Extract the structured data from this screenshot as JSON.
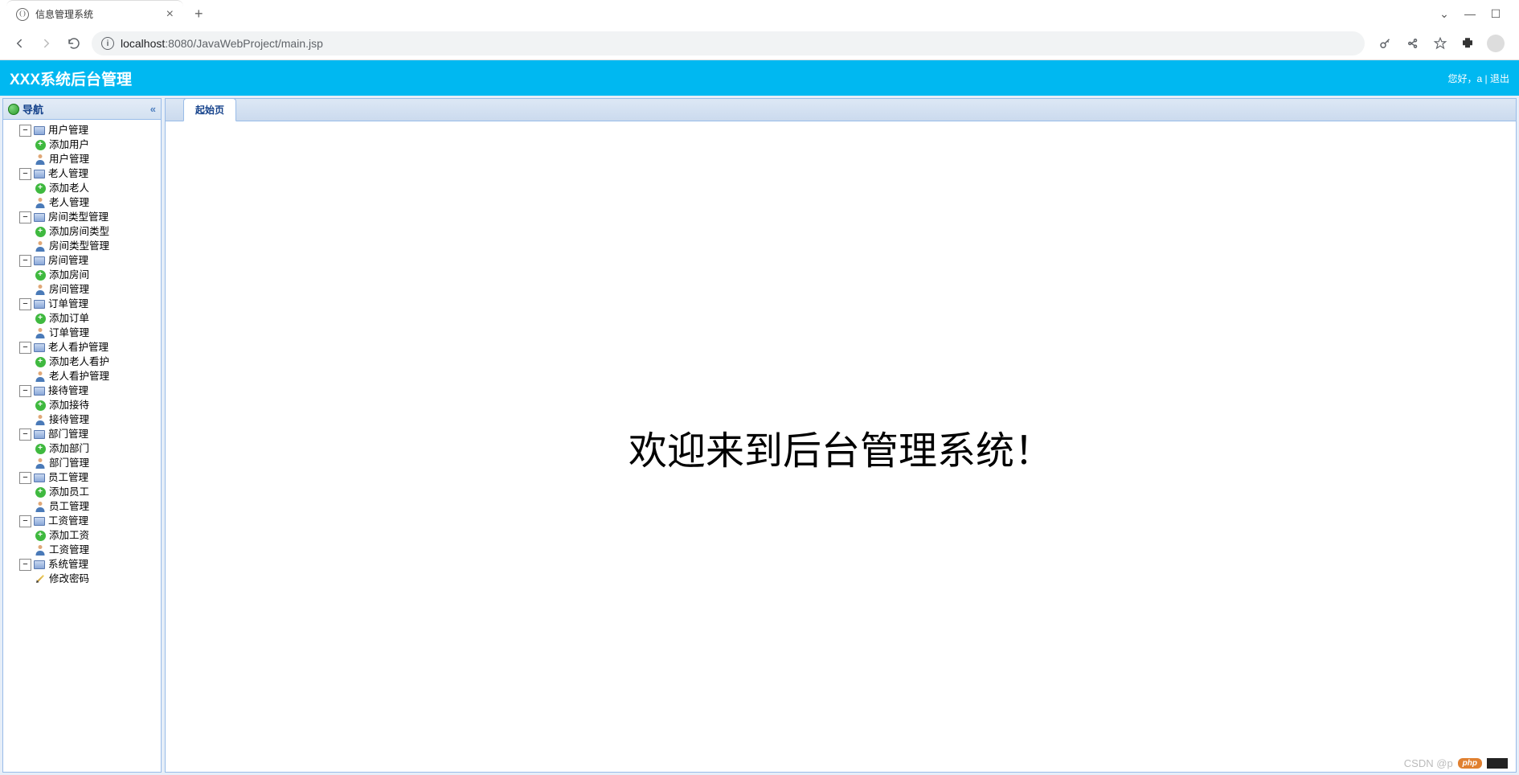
{
  "browser": {
    "tab_title": "信息管理系统",
    "url_host": "localhost",
    "url_port": ":8080",
    "url_path": "/JavaWebProject/main.jsp"
  },
  "header": {
    "title": "XXX系统后台管理",
    "greeting": "您好，a | 退出"
  },
  "sidebar": {
    "title": "导航"
  },
  "tree": [
    {
      "label": "用户管理",
      "icon": "module",
      "children": [
        {
          "label": "添加用户",
          "icon": "add"
        },
        {
          "label": "用户管理",
          "icon": "user"
        }
      ]
    },
    {
      "label": "老人管理",
      "icon": "module",
      "children": [
        {
          "label": "添加老人",
          "icon": "add"
        },
        {
          "label": "老人管理",
          "icon": "user"
        }
      ]
    },
    {
      "label": "房间类型管理",
      "icon": "module",
      "children": [
        {
          "label": "添加房间类型",
          "icon": "add"
        },
        {
          "label": "房间类型管理",
          "icon": "user"
        }
      ]
    },
    {
      "label": "房间管理",
      "icon": "module",
      "children": [
        {
          "label": "添加房间",
          "icon": "add"
        },
        {
          "label": "房间管理",
          "icon": "user"
        }
      ]
    },
    {
      "label": "订单管理",
      "icon": "module",
      "children": [
        {
          "label": "添加订单",
          "icon": "add"
        },
        {
          "label": "订单管理",
          "icon": "user"
        }
      ]
    },
    {
      "label": "老人看护管理",
      "icon": "module",
      "children": [
        {
          "label": "添加老人看护",
          "icon": "add"
        },
        {
          "label": "老人看护管理",
          "icon": "user"
        }
      ]
    },
    {
      "label": "接待管理",
      "icon": "module",
      "children": [
        {
          "label": "添加接待",
          "icon": "add"
        },
        {
          "label": "接待管理",
          "icon": "user"
        }
      ]
    },
    {
      "label": "部门管理",
      "icon": "module",
      "children": [
        {
          "label": "添加部门",
          "icon": "add"
        },
        {
          "label": "部门管理",
          "icon": "user"
        }
      ]
    },
    {
      "label": "员工管理",
      "icon": "module",
      "children": [
        {
          "label": "添加员工",
          "icon": "add"
        },
        {
          "label": "员工管理",
          "icon": "user"
        }
      ]
    },
    {
      "label": "工资管理",
      "icon": "module",
      "children": [
        {
          "label": "添加工资",
          "icon": "add"
        },
        {
          "label": "工资管理",
          "icon": "user"
        }
      ]
    },
    {
      "label": "系统管理",
      "icon": "module",
      "children": [
        {
          "label": "修改密码",
          "icon": "pencil"
        }
      ]
    }
  ],
  "tabs": {
    "start": "起始页"
  },
  "content": {
    "welcome": "欢迎来到后台管理系统！"
  },
  "watermark": {
    "text": "CSDN @p",
    "badge": "php"
  }
}
